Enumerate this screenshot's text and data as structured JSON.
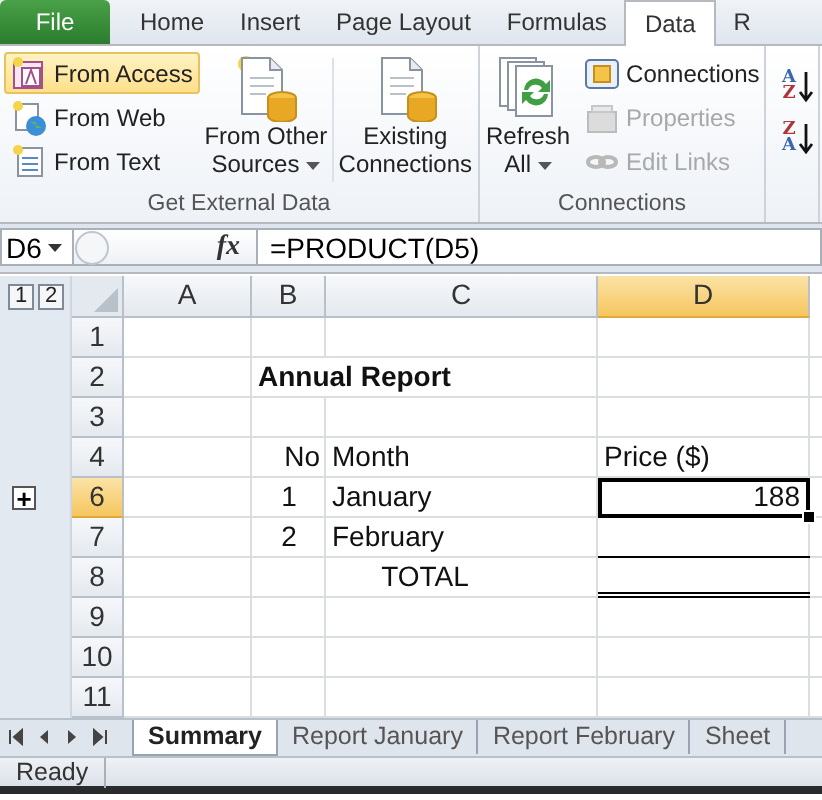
{
  "ribbon_tabs": [
    {
      "label": "File",
      "kind": "file",
      "selected": false
    },
    {
      "label": "Home",
      "kind": "tab",
      "selected": false
    },
    {
      "label": "Insert",
      "kind": "tab",
      "selected": false
    },
    {
      "label": "Page Layout",
      "kind": "tab",
      "selected": false
    },
    {
      "label": "Formulas",
      "kind": "tab",
      "selected": false
    },
    {
      "label": "Data",
      "kind": "tab",
      "selected": true
    },
    {
      "label": "R",
      "kind": "tab",
      "selected": false
    }
  ],
  "ribbon_groups": [
    {
      "label": "Get External Data",
      "items": [
        {
          "kind": "stack",
          "buttons": [
            {
              "label": "From Access",
              "hovered": true,
              "disabled": false
            },
            {
              "label": "From Web",
              "hovered": false,
              "disabled": false
            },
            {
              "label": "From Text",
              "hovered": false,
              "disabled": false
            }
          ]
        },
        {
          "kind": "large",
          "label": "From Other Sources",
          "dropdown": true
        },
        {
          "kind": "large",
          "label": "Existing Connections",
          "dropdown": false
        }
      ]
    },
    {
      "label": "Connections",
      "items": [
        {
          "kind": "large",
          "label": "Refresh All",
          "dropdown": true
        },
        {
          "kind": "stack",
          "buttons": [
            {
              "label": "Connections",
              "hovered": false,
              "disabled": false
            },
            {
              "label": "Properties",
              "hovered": false,
              "disabled": true
            },
            {
              "label": "Edit Links",
              "hovered": false,
              "disabled": true
            }
          ]
        }
      ]
    },
    {
      "items": [
        {
          "kind": "sort",
          "buttons": [
            {
              "top": "A",
              "bottom": "Z"
            },
            {
              "top": "Z",
              "bottom": "A"
            }
          ]
        }
      ]
    }
  ],
  "formula_bar": {
    "name_box": "D6",
    "function_label": "fx",
    "formula": "=PRODUCT(D5)"
  },
  "outline_levels": [
    "1",
    "2"
  ],
  "columns": [
    {
      "label": "A",
      "selected": false
    },
    {
      "label": "B",
      "selected": false
    },
    {
      "label": "C",
      "selected": false
    },
    {
      "label": "D",
      "selected": true
    }
  ],
  "rows": [
    {
      "header": "1",
      "selected": false,
      "cells": []
    },
    {
      "header": "2",
      "selected": false,
      "cells": [
        {
          "kind": "empty"
        },
        {
          "kind": "text",
          "text": "Annual Report",
          "bold": true
        }
      ]
    },
    {
      "header": "3",
      "selected": false,
      "cells": []
    },
    {
      "header": "4",
      "selected": false,
      "cells": [
        {
          "kind": "empty"
        },
        {
          "kind": "text",
          "text": "No",
          "align_right": true
        },
        {
          "kind": "text",
          "text": "Month"
        },
        {
          "kind": "text",
          "text": "Price ($)"
        }
      ]
    },
    {
      "header": "6",
      "selected": true,
      "outline_button": "+",
      "cells": [
        {
          "kind": "empty"
        },
        {
          "kind": "text",
          "text": "1",
          "centered": true
        },
        {
          "kind": "text",
          "text": "January"
        },
        {
          "kind": "text",
          "text": "188",
          "align_right": true,
          "active": true
        }
      ]
    },
    {
      "header": "7",
      "selected": false,
      "cells": [
        {
          "kind": "empty"
        },
        {
          "kind": "text",
          "text": "2",
          "centered": true
        },
        {
          "kind": "text",
          "text": "February"
        },
        {
          "kind": "empty",
          "border_bottom": true
        }
      ]
    },
    {
      "header": "8",
      "selected": false,
      "cells": [
        {
          "kind": "empty"
        },
        {
          "kind": "merged",
          "text": "TOTAL",
          "centered": true
        },
        {
          "kind": "empty",
          "double_border_bottom": true
        }
      ]
    },
    {
      "header": "9",
      "selected": false,
      "cells": []
    },
    {
      "header": "10",
      "selected": false,
      "cells": []
    },
    {
      "header": "11",
      "selected": false,
      "cells": []
    }
  ],
  "sheet_tabs": [
    {
      "label": "Summary",
      "selected": true
    },
    {
      "label": "Report January",
      "selected": false
    },
    {
      "label": "Report February",
      "selected": false
    },
    {
      "label": "Sheet",
      "selected": false
    }
  ],
  "status_bar": {
    "text": "Ready"
  }
}
